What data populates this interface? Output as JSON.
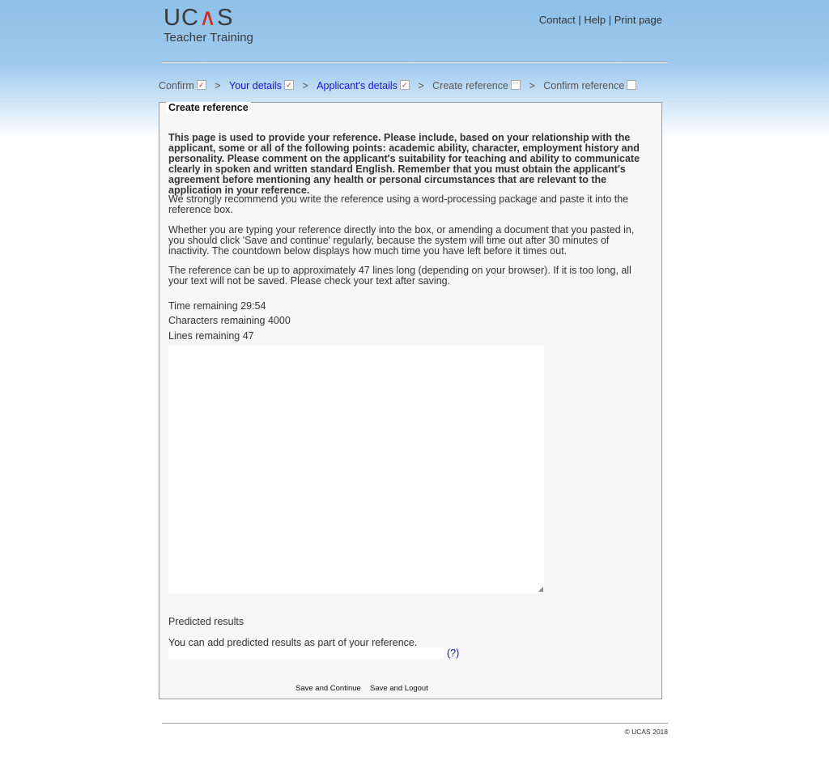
{
  "header": {
    "logo_brand": "UCAS",
    "logo_sub": "Teacher Training",
    "links": [
      "Contact",
      "Help",
      "Print page"
    ],
    "link_separator": "|"
  },
  "breadcrumb": {
    "steps": [
      {
        "label": "Confirm",
        "status": "complete"
      },
      {
        "label": "Your details",
        "status": "complete"
      },
      {
        "label": "Applicant's details",
        "status": "complete"
      },
      {
        "label": "Create reference",
        "status": "in-progress"
      },
      {
        "label": "Confirm reference",
        "status": "not-started"
      }
    ],
    "separator": ">"
  },
  "panel": {
    "legend": "Create reference",
    "intro": "This page is used to provide your reference. Please include, based on your relationship with the applicant, some or all of the following points: academic ability, character, employment history and personality. Please comment on the applicant's suitability for teaching and ability to communicate clearly in spoken and written standard English. Remember that you must obtain the applicant's agreement before mentioning any health or personal circumstances that are relevant to the application in your reference.",
    "para2": "We strongly recommend you write the reference using a word-processing package and paste it into the reference box.",
    "para3": "Whether you are typing your reference directly into the box, or amending a document that you pasted in, you should click 'Save and continue' regularly, because the system will time out after 30 minutes of inactivity. The countdown below displays how much time you have left before it times out.",
    "para4": "The reference can be up to approximately 47 lines long (depending on your browser). If it is too long, all your text will not be saved. Please check your text after saving.",
    "time_remaining": "Time remaining 29:54",
    "chars_remaining": "Characters remaining 4000",
    "lines_remaining": "Lines remaining 47",
    "reference_text": "",
    "predicted_title": "Predicted results",
    "predicted_note": "You can add predicted results as part of your reference.",
    "predicted_value": "",
    "help_link": "(?)",
    "save_continue": "Save and Continue",
    "save_logout": "Save and Logout"
  },
  "footer": {
    "copyright": "© UCAS 2018"
  }
}
